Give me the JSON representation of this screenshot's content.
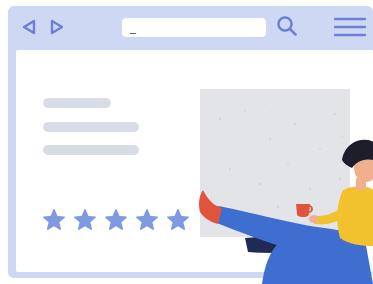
{
  "toolbar": {
    "back_icon": "back-arrow-icon",
    "forward_icon": "forward-arrow-icon",
    "address_value": "_",
    "search_icon": "search-icon",
    "menu_icon": "hamburger-menu-icon"
  },
  "rating": {
    "stars_filled": 5,
    "stars_total": 5
  },
  "colors": {
    "frame": "#cfd8f3",
    "accent": "#6b7fd7",
    "star": "#7f9ae0",
    "placeholder": "#e3e4e8",
    "text_line": "#d8dce6",
    "shirt": "#f2c12e",
    "pants": "#3f6ed1",
    "shoe": "#e0533c",
    "cup": "#e0533c",
    "hair": "#1d1d2b",
    "skin": "#f0b08e"
  }
}
